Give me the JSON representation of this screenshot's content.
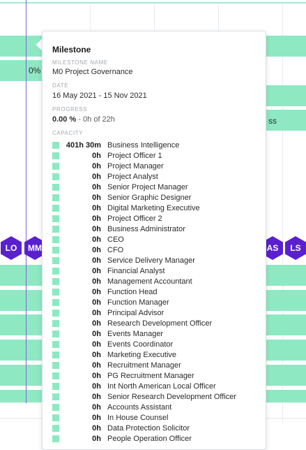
{
  "gantt": {
    "bar_texts": [
      "0%",
      "ss"
    ],
    "avatars_left": [
      "LO",
      "MM"
    ],
    "avatars_right": [
      "AS",
      "LS"
    ],
    "colors": {
      "bar": "#8ee9c3",
      "avatar": "#5a20cf",
      "today_line": "#7d5fe0"
    }
  },
  "tooltip": {
    "title": "Milestone",
    "milestone_name_label": "MILESTONE NAME",
    "milestone_name": "M0 Project Governance",
    "date_label": "DATE",
    "date": "16 May 2021 - 15 Nov 2021",
    "progress_label": "PROGRESS",
    "progress_percent": "0.00 %",
    "progress_detail": "- 0h of 22h",
    "capacity_label": "CAPACITY",
    "capacity": [
      {
        "hours": "401h 30m",
        "role": "Business Intelligence"
      },
      {
        "hours": "0h",
        "role": "Project Officer 1"
      },
      {
        "hours": "0h",
        "role": "Project Manager"
      },
      {
        "hours": "0h",
        "role": "Project Analyst"
      },
      {
        "hours": "0h",
        "role": "Senior Project Manager"
      },
      {
        "hours": "0h",
        "role": "Senior Graphic Designer"
      },
      {
        "hours": "0h",
        "role": "Digital Marketing Executive"
      },
      {
        "hours": "0h",
        "role": "Project Officer 2"
      },
      {
        "hours": "0h",
        "role": "Business Administrator"
      },
      {
        "hours": "0h",
        "role": "CEO"
      },
      {
        "hours": "0h",
        "role": "CFO"
      },
      {
        "hours": "0h",
        "role": "Service Delivery Manager"
      },
      {
        "hours": "0h",
        "role": "Financial Analyst"
      },
      {
        "hours": "0h",
        "role": "Management Accountant"
      },
      {
        "hours": "0h",
        "role": "Function Head"
      },
      {
        "hours": "0h",
        "role": "Function Manager"
      },
      {
        "hours": "0h",
        "role": "Principal Advisor"
      },
      {
        "hours": "0h",
        "role": "Research Development Officer"
      },
      {
        "hours": "0h",
        "role": "Events Manager"
      },
      {
        "hours": "0h",
        "role": "Events Coordinator"
      },
      {
        "hours": "0h",
        "role": "Marketing Executive"
      },
      {
        "hours": "0h",
        "role": "Recruitment Manager"
      },
      {
        "hours": "0h",
        "role": "PG Recruitment Manager"
      },
      {
        "hours": "0h",
        "role": "Int North American Local Officer"
      },
      {
        "hours": "0h",
        "role": "Senior Research Development Officer"
      },
      {
        "hours": "0h",
        "role": "Accounts Assistant"
      },
      {
        "hours": "0h",
        "role": "In House Counsel"
      },
      {
        "hours": "0h",
        "role": "Data Protection Solicitor"
      },
      {
        "hours": "0h",
        "role": "People Operation Officer"
      }
    ]
  }
}
